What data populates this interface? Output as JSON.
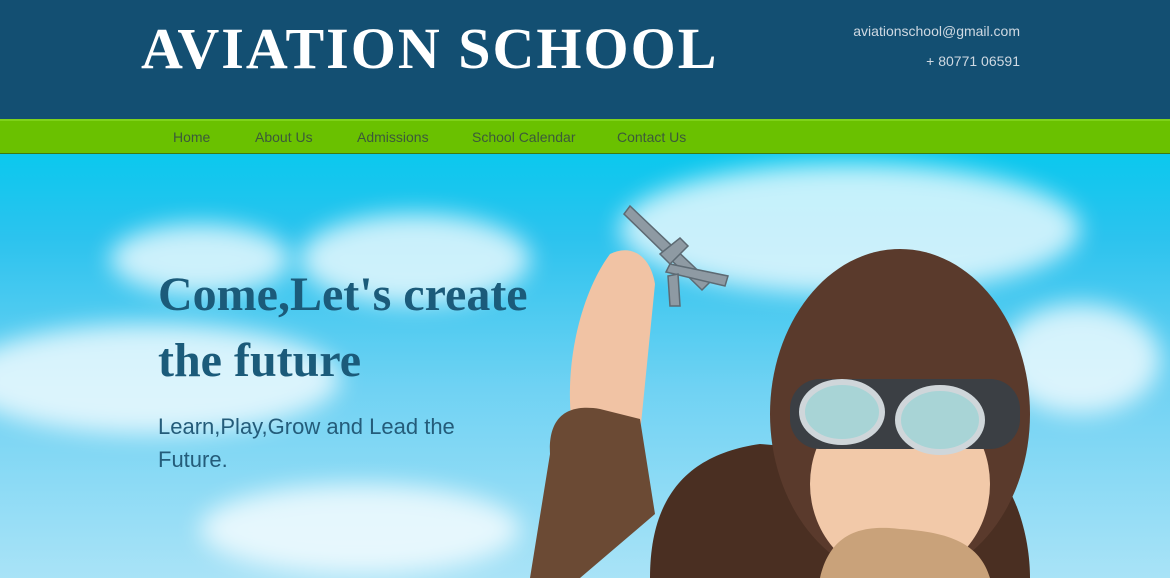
{
  "header": {
    "brand": "AVIATION SCHOOL",
    "email": "aviationschool@gmail.com",
    "phone": "+ 80771 06591"
  },
  "nav": {
    "items": [
      "Home",
      "About Us",
      "Admissions",
      "School Calendar",
      "Contact Us"
    ]
  },
  "hero": {
    "title": "Come,Let's create the future",
    "subtitle": "Learn,Play,Grow and Lead the Future.",
    "image": "boy-pilot-with-toy-airplane"
  },
  "colors": {
    "header_bg": "#134f72",
    "nav_bg": "#6ac100",
    "hero_title": "#1b5b7a",
    "sky": "#2cc3ee"
  }
}
